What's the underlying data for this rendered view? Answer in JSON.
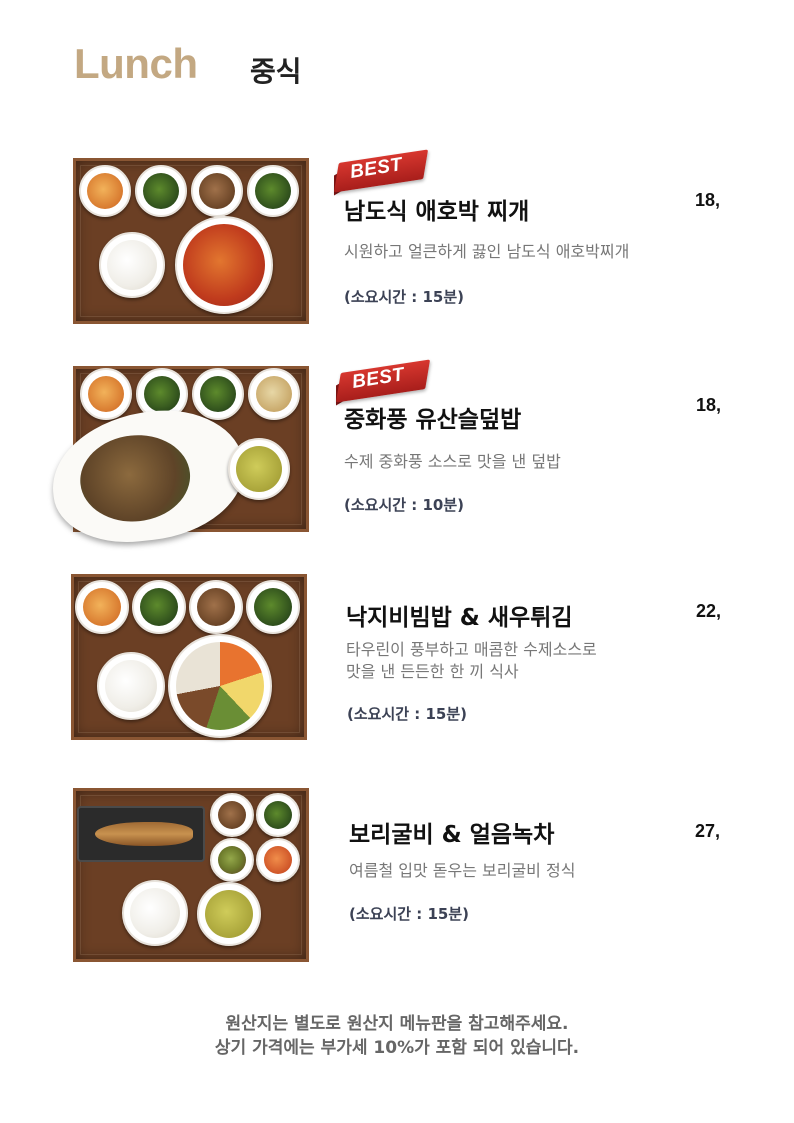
{
  "header": {
    "title": "Lunch",
    "subtitle": "중식"
  },
  "menu": [
    {
      "badge": "BEST",
      "name": "남도식 애호박 찌개",
      "price": "18,",
      "description": [
        "시원하고 얼큰하게 끓인 남도식 애호박찌개"
      ],
      "time": "(소요시간 : 15분)"
    },
    {
      "badge": "BEST",
      "name": "중화풍 유산슬덮밥",
      "price": "18,",
      "description": [
        "수제 중화풍 소스로 맛을 낸 덮밥"
      ],
      "time": "(소요시간 : 10분)"
    },
    {
      "badge": "",
      "name": "낙지비빔밥 & 새우튀김",
      "price": "22,",
      "description": [
        "타우린이 풍부하고 매콤한 수제소스로",
        "맛을 낸 든든한 한 끼 식사"
      ],
      "time": "(소요시간 : 15분)"
    },
    {
      "badge": "",
      "name": "보리굴비 & 얼음녹차",
      "price": "27,",
      "description": [
        "여름철 입맛 돋우는 보리굴비 정식"
      ],
      "time": "(소요시간 : 15분)"
    }
  ],
  "footer": {
    "line1": "원산지는 별도로 원산지 메뉴판을 참고해주세요.",
    "line2": "상기 가격에는 부가세 10%가 포함 되어 있습니다."
  }
}
